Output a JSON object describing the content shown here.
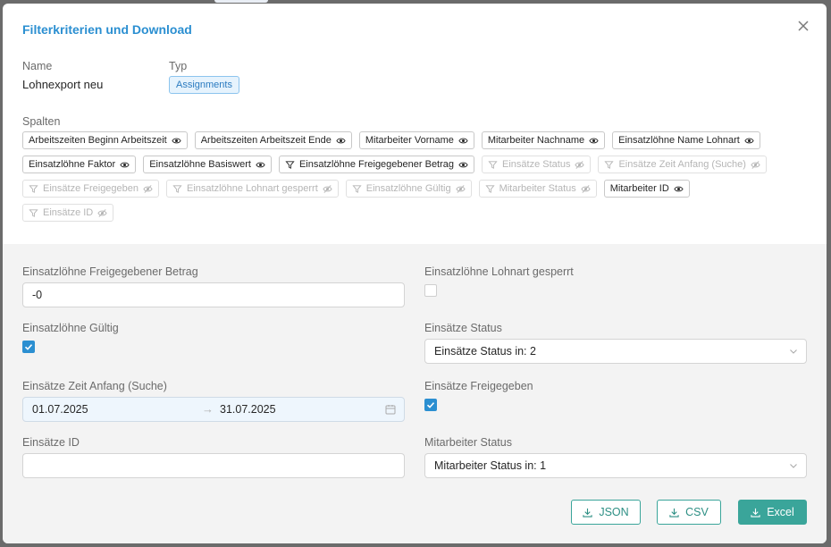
{
  "modal": {
    "title": "Filterkriterien und Download"
  },
  "meta": {
    "name_label": "Name",
    "name_value": "Lohnexport neu",
    "type_label": "Typ",
    "type_value": "Assignments"
  },
  "columns": {
    "label": "Spalten",
    "rows": [
      [
        {
          "label": "Arbeitszeiten Beginn Arbeitszeit",
          "filter": false,
          "visible": true
        },
        {
          "label": "Arbeitszeiten Arbeitszeit Ende",
          "filter": false,
          "visible": true
        },
        {
          "label": "Mitarbeiter Vorname",
          "filter": false,
          "visible": true
        },
        {
          "label": "Mitarbeiter Nachname",
          "filter": false,
          "visible": true
        },
        {
          "label": "Einsatzlöhne Name Lohnart",
          "filter": false,
          "visible": true
        }
      ],
      [
        {
          "label": "Einsatzlöhne Faktor",
          "filter": false,
          "visible": true
        },
        {
          "label": "Einsatzlöhne Basiswert",
          "filter": false,
          "visible": true
        },
        {
          "label": "Einsatzlöhne Freigegebener Betrag",
          "filter": true,
          "visible": true
        },
        {
          "label": "Einsätze Status",
          "filter": true,
          "visible": false
        },
        {
          "label": "Einsätze Zeit Anfang (Suche)",
          "filter": true,
          "visible": false
        }
      ],
      [
        {
          "label": "Einsätze Freigegeben",
          "filter": true,
          "visible": false
        },
        {
          "label": "Einsatzlöhne Lohnart gesperrt",
          "filter": true,
          "visible": false
        },
        {
          "label": "Einsatzlöhne Gültig",
          "filter": true,
          "visible": false
        },
        {
          "label": "Mitarbeiter Status",
          "filter": true,
          "visible": false
        },
        {
          "label": "Mitarbeiter ID",
          "filter": false,
          "visible": true
        }
      ],
      [
        {
          "label": "Einsätze ID",
          "filter": true,
          "visible": false
        }
      ]
    ]
  },
  "filters": {
    "freigegebener_betrag": {
      "label": "Einsatzlöhne Freigegebener Betrag",
      "value": "-0"
    },
    "lohnart_gesperrt": {
      "label": "Einsatzlöhne Lohnart gesperrt",
      "checked": false
    },
    "gueltig": {
      "label": "Einsatzlöhne Gültig",
      "checked": true
    },
    "einsaetze_status": {
      "label": "Einsätze Status",
      "value": "Einsätze Status in:  2"
    },
    "zeit_anfang": {
      "label": "Einsätze Zeit Anfang (Suche)",
      "start": "01.07.2025",
      "end": "31.07.2025",
      "arrow": "→"
    },
    "freigegeben": {
      "label": "Einsätze Freigegeben",
      "checked": true
    },
    "einsaetze_id": {
      "label": "Einsätze ID",
      "value": ""
    },
    "mitarbeiter_status": {
      "label": "Mitarbeiter Status",
      "value": "Mitarbeiter Status in:  1"
    }
  },
  "buttons": {
    "json": "JSON",
    "csv": "CSV",
    "excel": "Excel"
  },
  "colors": {
    "accent": "#2b8fd1",
    "primary_button": "#3aa59a"
  }
}
